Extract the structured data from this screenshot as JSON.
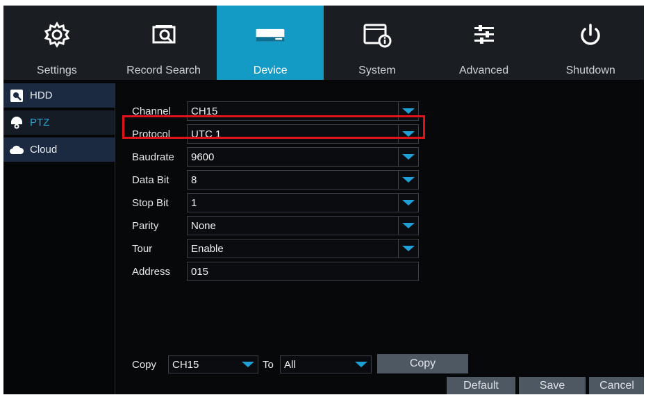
{
  "topnav": {
    "tabs": [
      {
        "label": "Settings",
        "icon": "gear-icon"
      },
      {
        "label": "Record Search",
        "icon": "record-search-icon"
      },
      {
        "label": "Device",
        "icon": "hard-drive-icon"
      },
      {
        "label": "System",
        "icon": "system-info-icon"
      },
      {
        "label": "Advanced",
        "icon": "sliders-icon"
      },
      {
        "label": "Shutdown",
        "icon": "power-icon"
      }
    ],
    "active": "Device"
  },
  "sidebar": {
    "items": [
      {
        "label": "HDD",
        "icon": "hdd-icon"
      },
      {
        "label": "PTZ",
        "icon": "ptz-camera-icon"
      },
      {
        "label": "Cloud",
        "icon": "cloud-icon"
      }
    ],
    "active": "PTZ"
  },
  "form": {
    "channel": {
      "label": "Channel",
      "value": "CH15"
    },
    "protocol": {
      "label": "Protocol",
      "value": "UTC 1"
    },
    "baudrate": {
      "label": "Baudrate",
      "value": "9600"
    },
    "data_bit": {
      "label": "Data Bit",
      "value": "8"
    },
    "stop_bit": {
      "label": "Stop Bit",
      "value": "1"
    },
    "parity": {
      "label": "Parity",
      "value": "None"
    },
    "tour": {
      "label": "Tour",
      "value": "Enable"
    },
    "address": {
      "label": "Address",
      "value": "015"
    }
  },
  "copy_row": {
    "copy_label": "Copy",
    "from_value": "CH15",
    "to_label": "To",
    "to_value": "All",
    "copy_button": "Copy"
  },
  "footer": {
    "default_label": "Default",
    "save_label": "Save",
    "cancel_label": "Cancel"
  },
  "colors": {
    "accent": "#139ac5",
    "highlight": "#e0131b",
    "background": "#07080a"
  }
}
